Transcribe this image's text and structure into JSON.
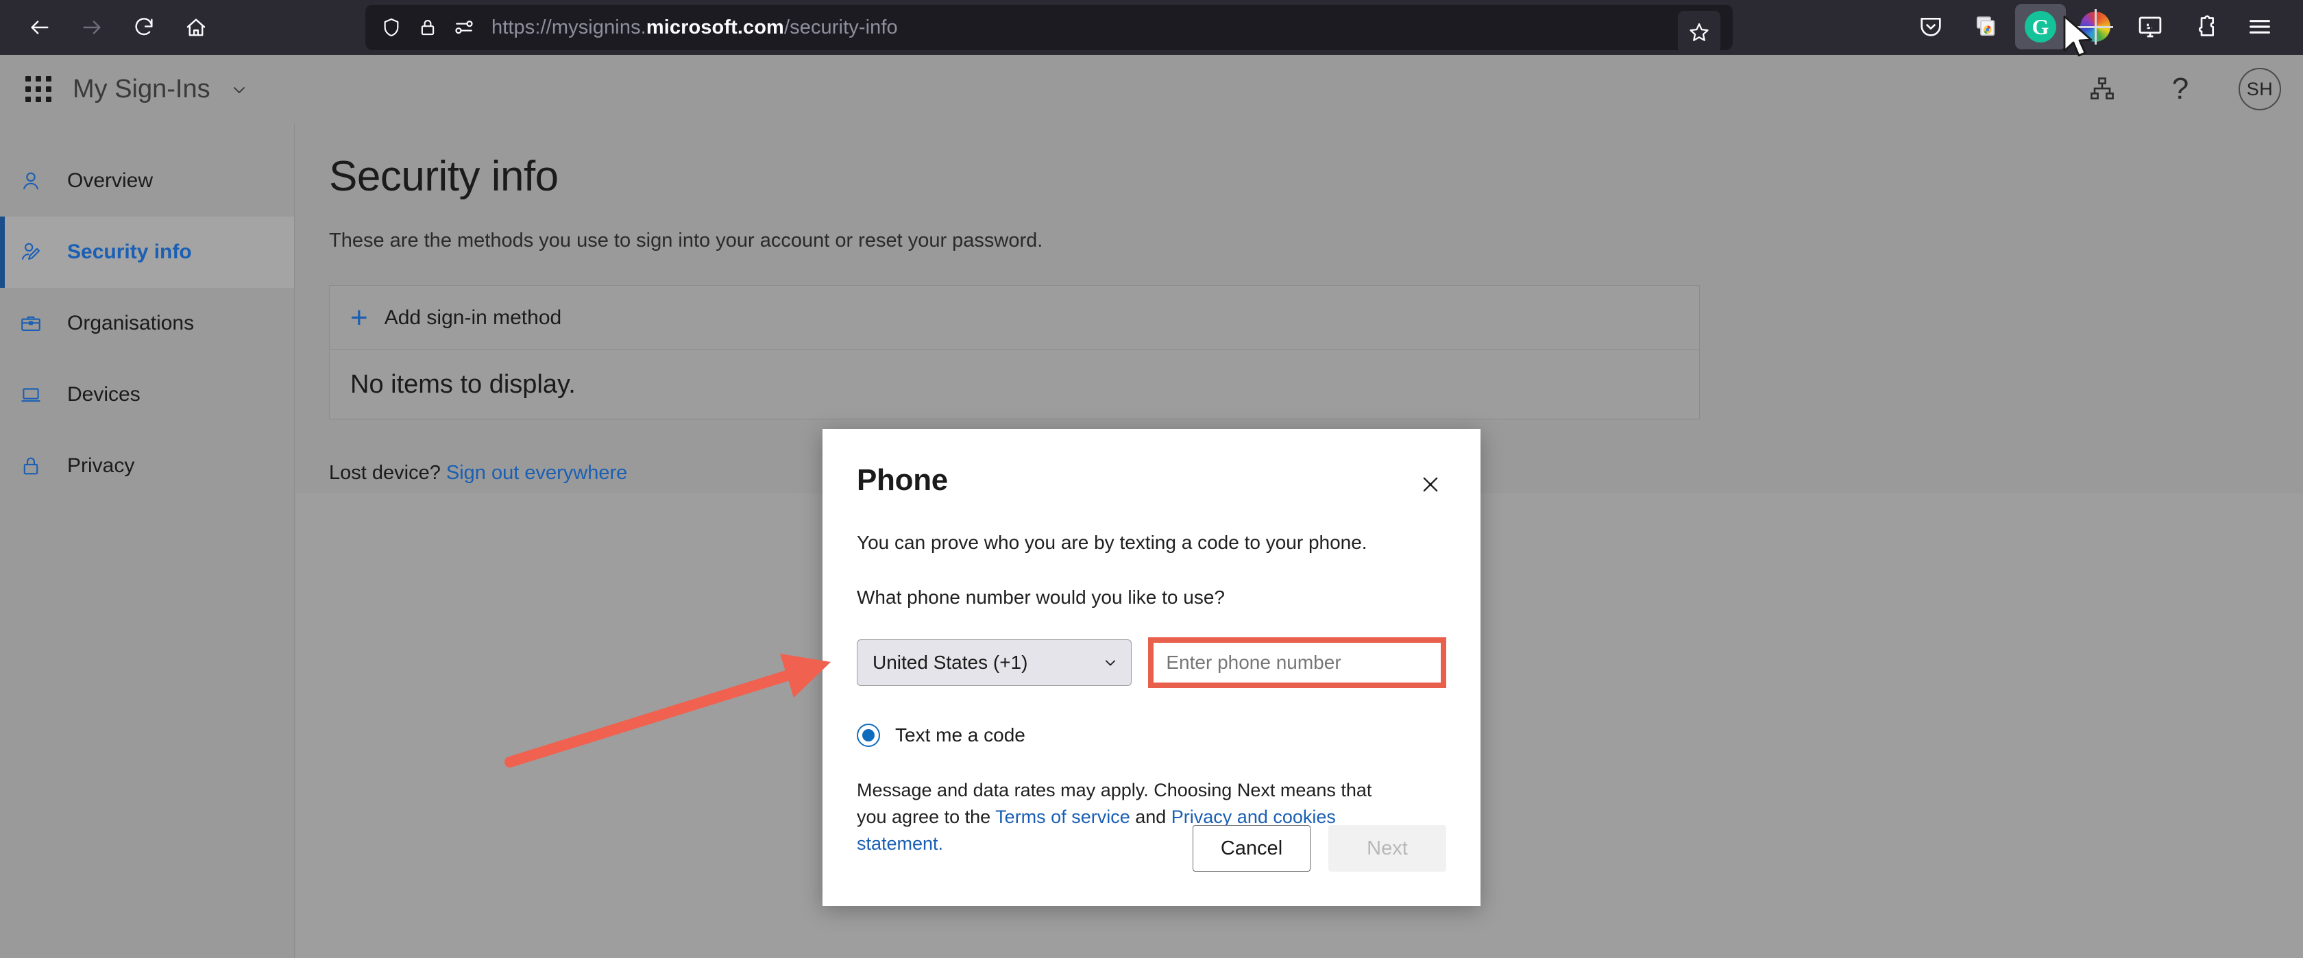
{
  "browser": {
    "nav": {
      "back_label": "Back",
      "forward_label": "Forward",
      "reload_label": "Reload",
      "home_label": "Home"
    },
    "url": {
      "scheme": "https://mysignins.",
      "host": "microsoft.com",
      "path": "/security-info",
      "full": "https://mysignins.microsoft.com/security-info"
    },
    "urlbar_icons": [
      "shield-icon",
      "padlock-icon",
      "permissions-icon"
    ],
    "bookmark_label": "Bookmark this page",
    "toolbar_buttons": [
      {
        "name": "pocket",
        "label": "Save to Pocket"
      },
      {
        "name": "tabs",
        "label": "Browser tabs"
      },
      {
        "name": "grammarly",
        "label": "Grammarly",
        "glyph": "G",
        "color": "#15c39a"
      },
      {
        "name": "color-picker",
        "label": "Colour picker"
      },
      {
        "name": "screenshot",
        "label": "Screenshot"
      },
      {
        "name": "extensions",
        "label": "Extensions"
      },
      {
        "name": "menu",
        "label": "Open application menu"
      }
    ]
  },
  "app_header": {
    "title": "My Sign-Ins",
    "waffle_label": "App launcher",
    "org_icon_label": "Organisation",
    "help_label": "?",
    "avatar_initials": "SH"
  },
  "sidebar": {
    "items": [
      {
        "label": "Overview",
        "icon": "person-icon",
        "active": false
      },
      {
        "label": "Security info",
        "icon": "person-edit-icon",
        "active": true
      },
      {
        "label": "Organisations",
        "icon": "briefcase-icon",
        "active": false
      },
      {
        "label": "Devices",
        "icon": "laptop-icon",
        "active": false
      },
      {
        "label": "Privacy",
        "icon": "lock-icon",
        "active": false
      }
    ]
  },
  "main": {
    "title": "Security info",
    "subtitle": "These are the methods you use to sign into your account or reset your password.",
    "add_method_label": "Add sign-in method",
    "empty_state": "No items to display.",
    "lost_device_text": "Lost device?",
    "sign_out_link": "Sign out everywhere"
  },
  "modal": {
    "title": "Phone",
    "close_label": "Close",
    "description": "You can prove who you are by texting a code to your phone.",
    "question": "What phone number would you like to use?",
    "country": {
      "selected": "United States (+1)",
      "options": [
        "United States (+1)"
      ]
    },
    "phone_field": {
      "placeholder": "Enter phone number",
      "value": ""
    },
    "radio": {
      "label": "Text me a code",
      "selected": true
    },
    "terms": {
      "prefix": "Message and data rates may apply. Choosing Next means that you agree to the ",
      "link1": "Terms of service",
      "middle": " and ",
      "link2": "Privacy and cookies statement.",
      "suffix": ""
    },
    "cancel_label": "Cancel",
    "next_label": "Next",
    "next_disabled": true
  },
  "annotation": {
    "arrow_color": "#f0614f",
    "highlight_color": "#e8604c",
    "highlight_target": "phone-number-input"
  }
}
